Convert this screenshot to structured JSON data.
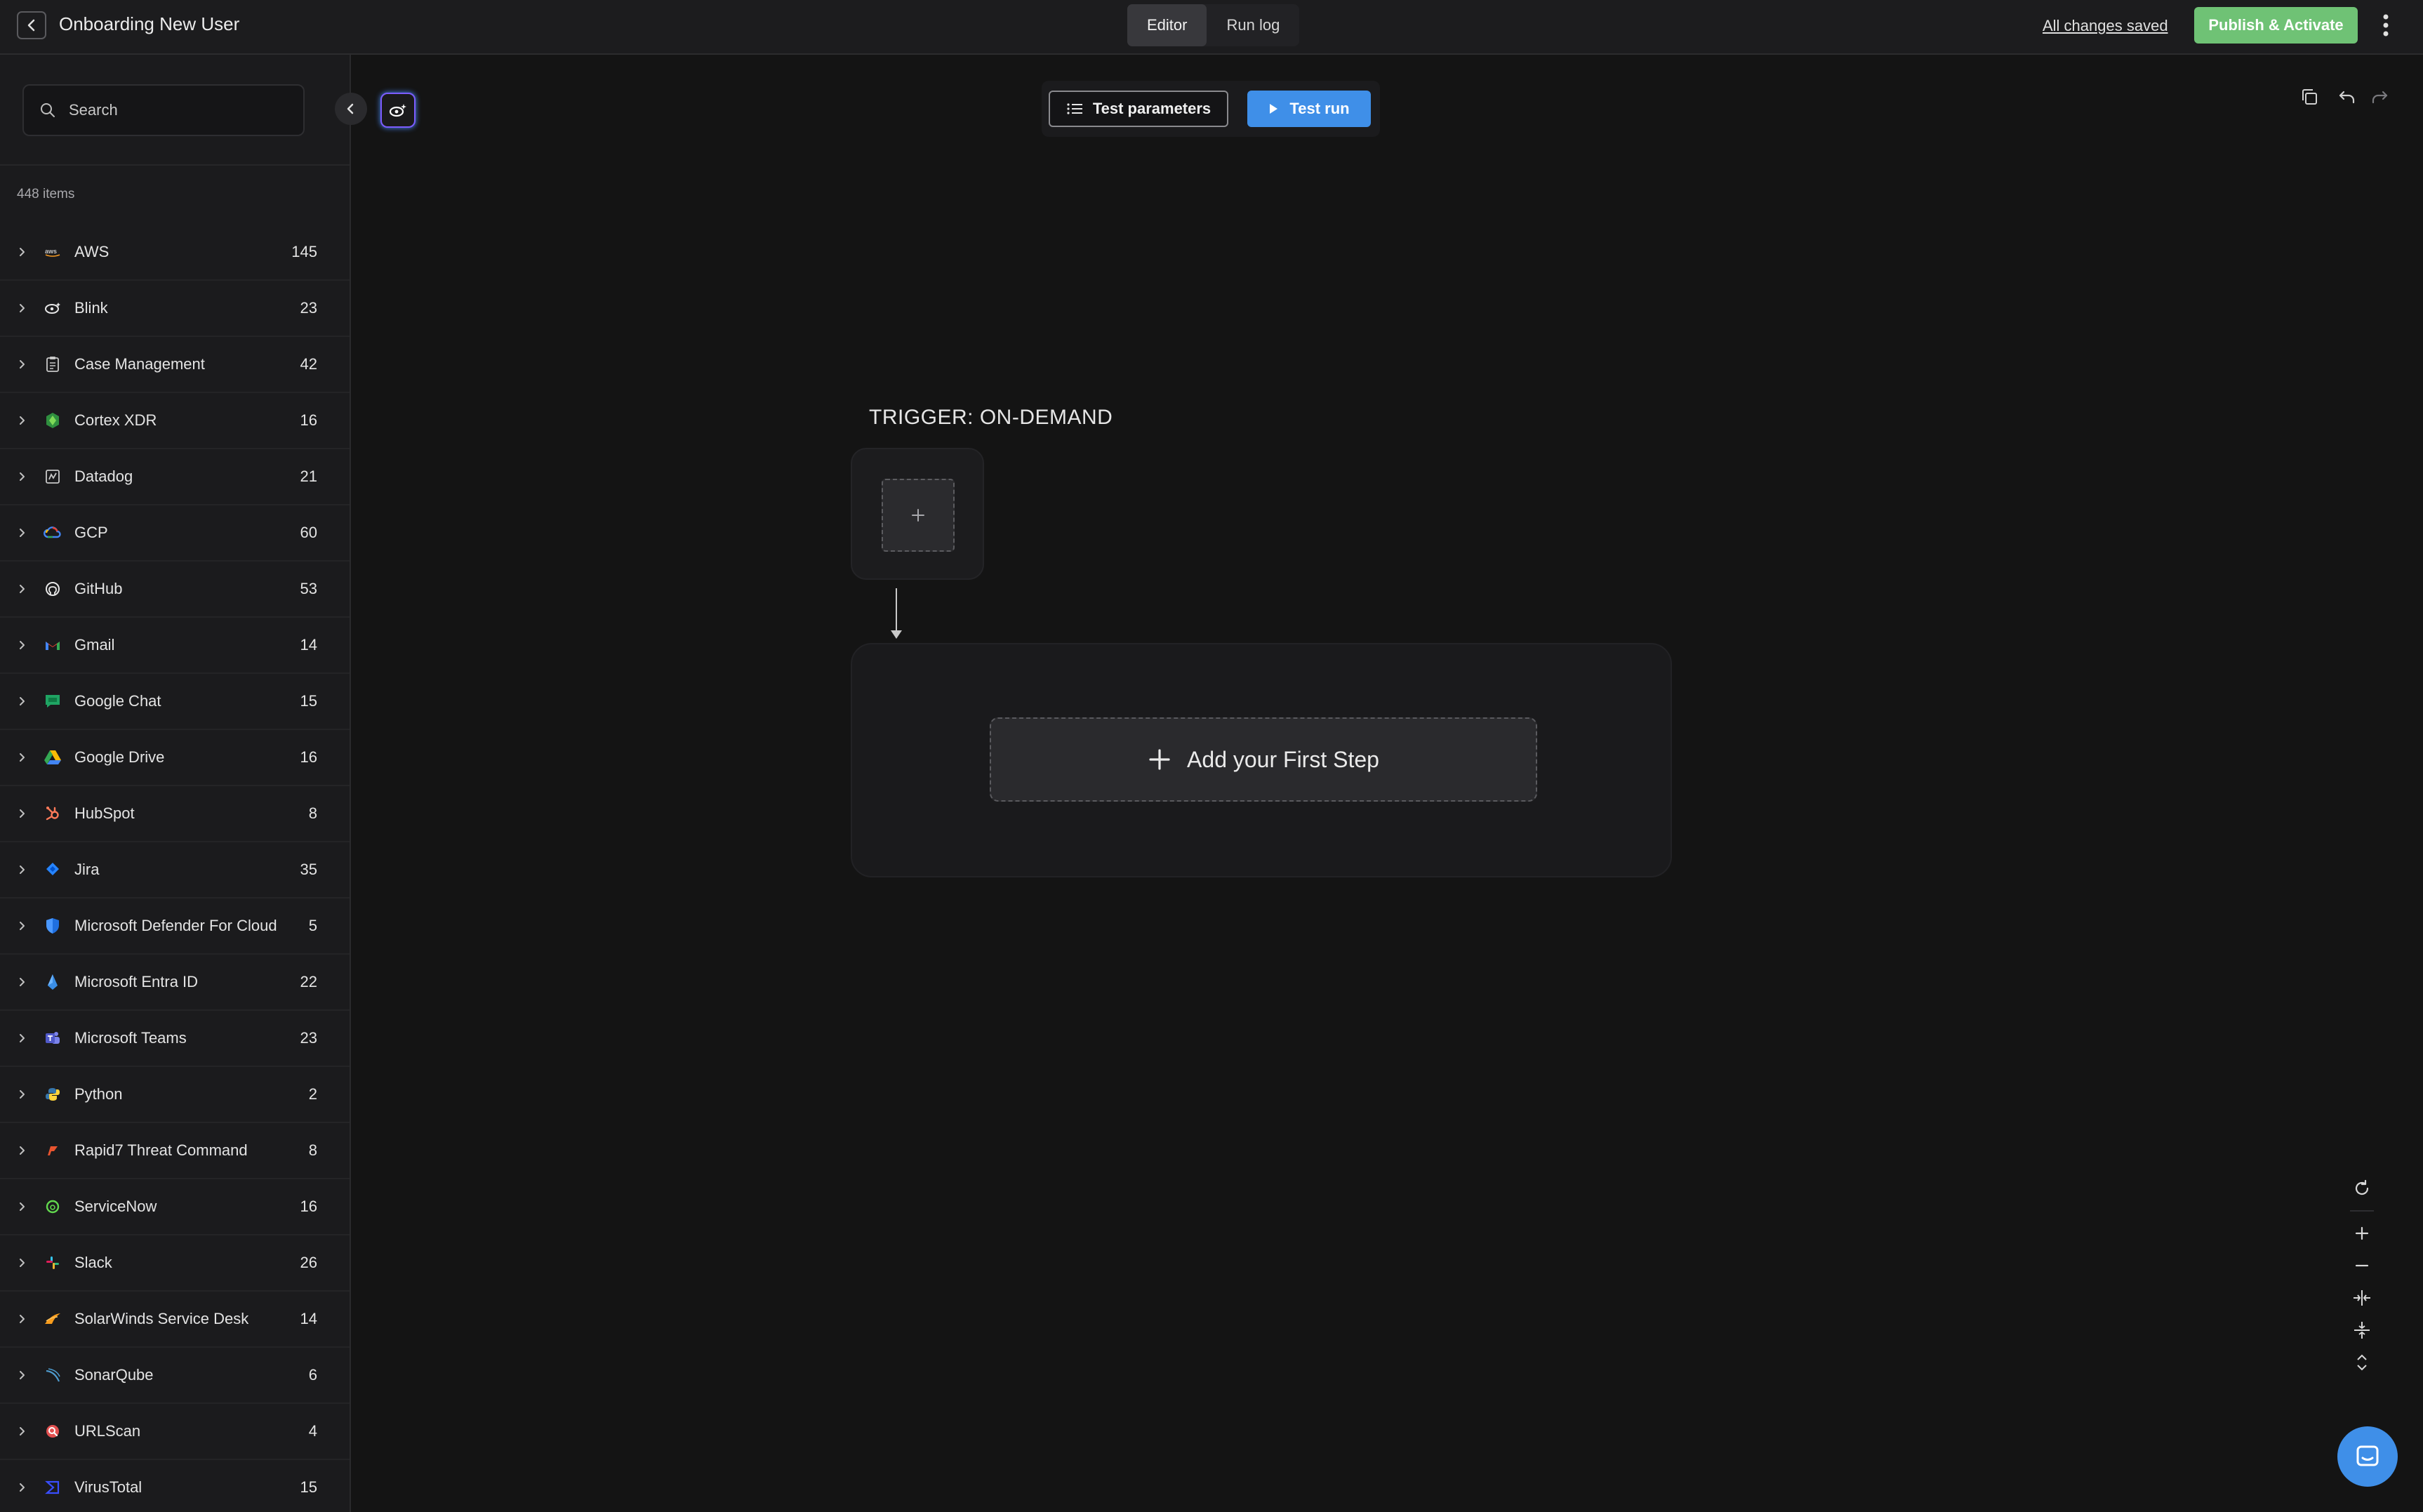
{
  "header": {
    "title": "Onboarding New User",
    "tabs": [
      {
        "label": "Editor",
        "active": true
      },
      {
        "label": "Run log",
        "active": false
      }
    ],
    "save_status": "All changes saved",
    "publish_label": "Publish & Activate"
  },
  "sidebar": {
    "search_placeholder": "Search",
    "items_count": "448 items",
    "providers": [
      {
        "name": "AWS",
        "count": "145",
        "icon": "aws-icon"
      },
      {
        "name": "Blink",
        "count": "23",
        "icon": "blink-icon"
      },
      {
        "name": "Case Management",
        "count": "42",
        "icon": "case-management-icon"
      },
      {
        "name": "Cortex XDR",
        "count": "16",
        "icon": "cortex-xdr-icon"
      },
      {
        "name": "Datadog",
        "count": "21",
        "icon": "datadog-icon"
      },
      {
        "name": "GCP",
        "count": "60",
        "icon": "gcp-icon"
      },
      {
        "name": "GitHub",
        "count": "53",
        "icon": "github-icon"
      },
      {
        "name": "Gmail",
        "count": "14",
        "icon": "gmail-icon"
      },
      {
        "name": "Google Chat",
        "count": "15",
        "icon": "google-chat-icon"
      },
      {
        "name": "Google Drive",
        "count": "16",
        "icon": "google-drive-icon"
      },
      {
        "name": "HubSpot",
        "count": "8",
        "icon": "hubspot-icon"
      },
      {
        "name": "Jira",
        "count": "35",
        "icon": "jira-icon"
      },
      {
        "name": "Microsoft Defender For Cloud",
        "count": "5",
        "icon": "defender-icon"
      },
      {
        "name": "Microsoft Entra ID",
        "count": "22",
        "icon": "entra-id-icon"
      },
      {
        "name": "Microsoft Teams",
        "count": "23",
        "icon": "teams-icon"
      },
      {
        "name": "Python",
        "count": "2",
        "icon": "python-icon"
      },
      {
        "name": "Rapid7 Threat Command",
        "count": "8",
        "icon": "rapid7-icon"
      },
      {
        "name": "ServiceNow",
        "count": "16",
        "icon": "servicenow-icon"
      },
      {
        "name": "Slack",
        "count": "26",
        "icon": "slack-icon"
      },
      {
        "name": "SolarWinds Service Desk",
        "count": "14",
        "icon": "solarwinds-icon"
      },
      {
        "name": "SonarQube",
        "count": "6",
        "icon": "sonarqube-icon"
      },
      {
        "name": "URLScan",
        "count": "4",
        "icon": "urlscan-icon"
      },
      {
        "name": "VirusTotal",
        "count": "15",
        "icon": "virustotal-icon"
      }
    ]
  },
  "canvas": {
    "test_parameters_label": "Test parameters",
    "test_run_label": "Test run",
    "trigger_label": "TRIGGER: ON-DEMAND",
    "add_first_step_label": "Add your First Step"
  },
  "colors": {
    "publish": "#6fc275",
    "test_run": "#3f8fe8",
    "background": "#141414",
    "sidebar": "#1b1b1d"
  }
}
